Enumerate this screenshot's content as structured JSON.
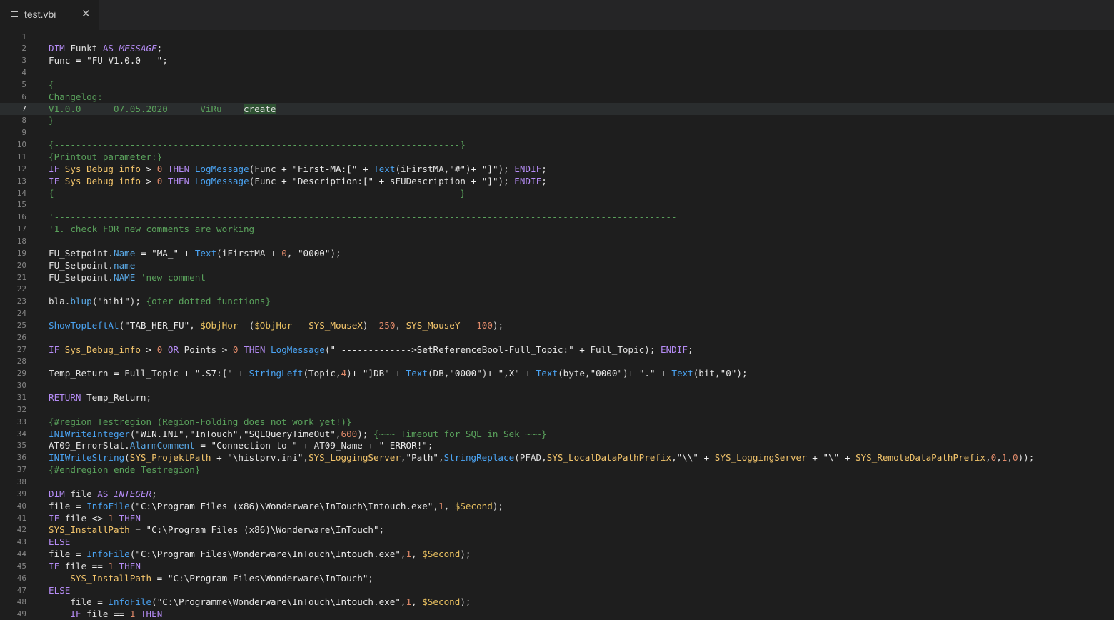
{
  "tab": {
    "title": "test.vbi",
    "icon": "file-lines-icon",
    "close_icon": "close-icon",
    "close_glyph": "✕"
  },
  "editor": {
    "current_line": 7,
    "lines": [
      [],
      [
        [
          "k",
          "DIM"
        ],
        [
          "x",
          " Funkt "
        ],
        [
          "k",
          "AS"
        ],
        [
          "x",
          " "
        ],
        [
          "t",
          "MESSAGE"
        ],
        [
          "x",
          ";"
        ]
      ],
      [
        [
          "x",
          "Func "
        ],
        [
          "o",
          "="
        ],
        [
          "x",
          " "
        ],
        [
          "s",
          "\"FU V1.0.0 - \""
        ],
        [
          "x",
          ";"
        ]
      ],
      [],
      [
        [
          "c",
          "{"
        ]
      ],
      [
        [
          "c",
          "Changelog:"
        ]
      ],
      [
        [
          "c",
          "V1.0.0      07.05.2020      ViRu    "
        ],
        [
          "hl",
          "create"
        ]
      ],
      [
        [
          "c",
          "}"
        ]
      ],
      [],
      [
        [
          "c",
          "{---------------------------------------------------------------------------}"
        ]
      ],
      [
        [
          "c",
          "{Printout parameter:}"
        ]
      ],
      [
        [
          "k",
          "IF"
        ],
        [
          "x",
          " "
        ],
        [
          "v",
          "Sys_Debug_info"
        ],
        [
          "x",
          " "
        ],
        [
          "o",
          ">"
        ],
        [
          "x",
          " "
        ],
        [
          "n",
          "0"
        ],
        [
          "x",
          " "
        ],
        [
          "k",
          "THEN"
        ],
        [
          "x",
          " "
        ],
        [
          "f",
          "LogMessage"
        ],
        [
          "x",
          "(Func "
        ],
        [
          "o",
          "+"
        ],
        [
          "x",
          " "
        ],
        [
          "s",
          "\"First-MA:[\""
        ],
        [
          "x",
          " "
        ],
        [
          "o",
          "+"
        ],
        [
          "x",
          " "
        ],
        [
          "f",
          "Text"
        ],
        [
          "x",
          "(iFirstMA,"
        ],
        [
          "s",
          "\"#\""
        ],
        [
          "x",
          ")"
        ],
        [
          "o",
          "+"
        ],
        [
          "x",
          " "
        ],
        [
          "s",
          "\"]\""
        ],
        [
          "x",
          "); "
        ],
        [
          "k",
          "ENDIF"
        ],
        [
          "x",
          ";"
        ]
      ],
      [
        [
          "k",
          "IF"
        ],
        [
          "x",
          " "
        ],
        [
          "v",
          "Sys_Debug_info"
        ],
        [
          "x",
          " "
        ],
        [
          "o",
          ">"
        ],
        [
          "x",
          " "
        ],
        [
          "n",
          "0"
        ],
        [
          "x",
          " "
        ],
        [
          "k",
          "THEN"
        ],
        [
          "x",
          " "
        ],
        [
          "f",
          "LogMessage"
        ],
        [
          "x",
          "(Func "
        ],
        [
          "o",
          "+"
        ],
        [
          "x",
          " "
        ],
        [
          "s",
          "\"Description:[\""
        ],
        [
          "x",
          " "
        ],
        [
          "o",
          "+"
        ],
        [
          "x",
          " sFUDescription "
        ],
        [
          "o",
          "+"
        ],
        [
          "x",
          " "
        ],
        [
          "s",
          "\"]\""
        ],
        [
          "x",
          "); "
        ],
        [
          "k",
          "ENDIF"
        ],
        [
          "x",
          ";"
        ]
      ],
      [
        [
          "c",
          "{---------------------------------------------------------------------------}"
        ]
      ],
      [],
      [
        [
          "c",
          "'-------------------------------------------------------------------------------------------------------------------"
        ]
      ],
      [
        [
          "c",
          "'1. check FOR new comments are working"
        ]
      ],
      [],
      [
        [
          "x",
          "FU_Setpoint."
        ],
        [
          "p",
          "Name"
        ],
        [
          "x",
          " "
        ],
        [
          "o",
          "="
        ],
        [
          "x",
          " "
        ],
        [
          "s",
          "\"MA_\""
        ],
        [
          "x",
          " "
        ],
        [
          "o",
          "+"
        ],
        [
          "x",
          " "
        ],
        [
          "f",
          "Text"
        ],
        [
          "x",
          "(iFirstMA "
        ],
        [
          "o",
          "+"
        ],
        [
          "x",
          " "
        ],
        [
          "n",
          "0"
        ],
        [
          "x",
          ", "
        ],
        [
          "s",
          "\"0000\""
        ],
        [
          "x",
          ");"
        ]
      ],
      [
        [
          "x",
          "FU_Setpoint."
        ],
        [
          "p",
          "name"
        ]
      ],
      [
        [
          "x",
          "FU_Setpoint."
        ],
        [
          "p",
          "NAME"
        ],
        [
          "x",
          " "
        ],
        [
          "c",
          "'new comment"
        ]
      ],
      [],
      [
        [
          "x",
          "bla."
        ],
        [
          "p",
          "blup"
        ],
        [
          "x",
          "("
        ],
        [
          "s",
          "\"hihi\""
        ],
        [
          "x",
          "); "
        ],
        [
          "c",
          "{oter dotted functions}"
        ]
      ],
      [],
      [
        [
          "f",
          "ShowTopLeftAt"
        ],
        [
          "x",
          "("
        ],
        [
          "s",
          "\"TAB_HER_FU\""
        ],
        [
          "x",
          ", "
        ],
        [
          "d",
          "$ObjHor"
        ],
        [
          "x",
          " "
        ],
        [
          "o",
          "-"
        ],
        [
          "x",
          "("
        ],
        [
          "d",
          "$ObjHor"
        ],
        [
          "x",
          " "
        ],
        [
          "o",
          "-"
        ],
        [
          "x",
          " "
        ],
        [
          "v",
          "SYS_MouseX"
        ],
        [
          "x",
          ")"
        ],
        [
          "o",
          "-"
        ],
        [
          "x",
          " "
        ],
        [
          "n",
          "250"
        ],
        [
          "x",
          ", "
        ],
        [
          "v",
          "SYS_MouseY"
        ],
        [
          "x",
          " "
        ],
        [
          "o",
          "-"
        ],
        [
          "x",
          " "
        ],
        [
          "n",
          "100"
        ],
        [
          "x",
          ");"
        ]
      ],
      [],
      [
        [
          "k",
          "IF"
        ],
        [
          "x",
          " "
        ],
        [
          "v",
          "Sys_Debug_info"
        ],
        [
          "x",
          " "
        ],
        [
          "o",
          ">"
        ],
        [
          "x",
          " "
        ],
        [
          "n",
          "0"
        ],
        [
          "x",
          " "
        ],
        [
          "k",
          "OR"
        ],
        [
          "x",
          " Points "
        ],
        [
          "o",
          ">"
        ],
        [
          "x",
          " "
        ],
        [
          "n",
          "0"
        ],
        [
          "x",
          " "
        ],
        [
          "k",
          "THEN"
        ],
        [
          "x",
          " "
        ],
        [
          "f",
          "LogMessage"
        ],
        [
          "x",
          "("
        ],
        [
          "s",
          "\" ------------->SetReferenceBool-Full_Topic:\""
        ],
        [
          "x",
          " "
        ],
        [
          "o",
          "+"
        ],
        [
          "x",
          " Full_Topic); "
        ],
        [
          "k",
          "ENDIF"
        ],
        [
          "x",
          ";"
        ]
      ],
      [],
      [
        [
          "x",
          "Temp_Return "
        ],
        [
          "o",
          "="
        ],
        [
          "x",
          " Full_Topic "
        ],
        [
          "o",
          "+"
        ],
        [
          "x",
          " "
        ],
        [
          "s",
          "\".S7:[\""
        ],
        [
          "x",
          " "
        ],
        [
          "o",
          "+"
        ],
        [
          "x",
          " "
        ],
        [
          "f",
          "StringLeft"
        ],
        [
          "x",
          "(Topic,"
        ],
        [
          "n",
          "4"
        ],
        [
          "x",
          ")"
        ],
        [
          "o",
          "+"
        ],
        [
          "x",
          " "
        ],
        [
          "s",
          "\"]DB\""
        ],
        [
          "x",
          " "
        ],
        [
          "o",
          "+"
        ],
        [
          "x",
          " "
        ],
        [
          "f",
          "Text"
        ],
        [
          "x",
          "(DB,"
        ],
        [
          "s",
          "\"0000\""
        ],
        [
          "x",
          ")"
        ],
        [
          "o",
          "+"
        ],
        [
          "x",
          " "
        ],
        [
          "s",
          "\",X\""
        ],
        [
          "x",
          " "
        ],
        [
          "o",
          "+"
        ],
        [
          "x",
          " "
        ],
        [
          "f",
          "Text"
        ],
        [
          "x",
          "(byte,"
        ],
        [
          "s",
          "\"0000\""
        ],
        [
          "x",
          ")"
        ],
        [
          "o",
          "+"
        ],
        [
          "x",
          " "
        ],
        [
          "s",
          "\".\""
        ],
        [
          "x",
          " "
        ],
        [
          "o",
          "+"
        ],
        [
          "x",
          " "
        ],
        [
          "f",
          "Text"
        ],
        [
          "x",
          "(bit,"
        ],
        [
          "s",
          "\"0\""
        ],
        [
          "x",
          ");"
        ]
      ],
      [],
      [
        [
          "k",
          "RETURN"
        ],
        [
          "x",
          " Temp_Return;"
        ]
      ],
      [],
      [
        [
          "c",
          "{#region Testregion (Region-Folding does not work yet!)}"
        ]
      ],
      [
        [
          "f",
          "INIWriteInteger"
        ],
        [
          "x",
          "("
        ],
        [
          "s",
          "\"WIN.INI\""
        ],
        [
          "x",
          ","
        ],
        [
          "s",
          "\"InTouch\""
        ],
        [
          "x",
          ","
        ],
        [
          "s",
          "\"SQLQueryTimeOut\""
        ],
        [
          "x",
          ","
        ],
        [
          "n",
          "600"
        ],
        [
          "x",
          "); "
        ],
        [
          "c",
          "{~~~ Timeout for SQL in Sek ~~~}"
        ]
      ],
      [
        [
          "x",
          "AT09_ErrorStat."
        ],
        [
          "p",
          "AlarmComment"
        ],
        [
          "x",
          " "
        ],
        [
          "o",
          "="
        ],
        [
          "x",
          " "
        ],
        [
          "s",
          "\"Connection to \""
        ],
        [
          "x",
          " "
        ],
        [
          "o",
          "+"
        ],
        [
          "x",
          " AT09_Name "
        ],
        [
          "o",
          "+"
        ],
        [
          "x",
          " "
        ],
        [
          "s",
          "\" ERROR!\""
        ],
        [
          "x",
          ";"
        ]
      ],
      [
        [
          "f",
          "INIWriteString"
        ],
        [
          "x",
          "("
        ],
        [
          "v",
          "SYS_ProjektPath"
        ],
        [
          "x",
          " "
        ],
        [
          "o",
          "+"
        ],
        [
          "x",
          " "
        ],
        [
          "s",
          "\"\\histprv.ini\""
        ],
        [
          "x",
          ","
        ],
        [
          "v",
          "SYS_LoggingServer"
        ],
        [
          "x",
          ","
        ],
        [
          "s",
          "\"Path\""
        ],
        [
          "x",
          ","
        ],
        [
          "f",
          "StringReplace"
        ],
        [
          "x",
          "(PFAD,"
        ],
        [
          "v",
          "SYS_LocalDataPathPrefix"
        ],
        [
          "x",
          ","
        ],
        [
          "s",
          "\"\\\\\""
        ],
        [
          "x",
          " "
        ],
        [
          "o",
          "+"
        ],
        [
          "x",
          " "
        ],
        [
          "v",
          "SYS_LoggingServer"
        ],
        [
          "x",
          " "
        ],
        [
          "o",
          "+"
        ],
        [
          "x",
          " "
        ],
        [
          "s",
          "\"\\\""
        ],
        [
          "x",
          " "
        ],
        [
          "o",
          "+"
        ],
        [
          "x",
          " "
        ],
        [
          "v",
          "SYS_RemoteDataPathPrefix"
        ],
        [
          "x",
          ","
        ],
        [
          "n",
          "0"
        ],
        [
          "x",
          ","
        ],
        [
          "n",
          "1"
        ],
        [
          "x",
          ","
        ],
        [
          "n",
          "0"
        ],
        [
          "x",
          "));"
        ]
      ],
      [
        [
          "c",
          "{#endregion ende Testregion}"
        ]
      ],
      [],
      [
        [
          "k",
          "DIM"
        ],
        [
          "x",
          " file "
        ],
        [
          "k",
          "AS"
        ],
        [
          "x",
          " "
        ],
        [
          "t",
          "INTEGER"
        ],
        [
          "x",
          ";"
        ]
      ],
      [
        [
          "x",
          "file "
        ],
        [
          "o",
          "="
        ],
        [
          "x",
          " "
        ],
        [
          "f",
          "InfoFile"
        ],
        [
          "x",
          "("
        ],
        [
          "s",
          "\"C:\\Program Files (x86)\\Wonderware\\InTouch\\Intouch.exe\""
        ],
        [
          "x",
          ","
        ],
        [
          "n",
          "1"
        ],
        [
          "x",
          ", "
        ],
        [
          "d",
          "$Second"
        ],
        [
          "x",
          ");"
        ]
      ],
      [
        [
          "k",
          "IF"
        ],
        [
          "x",
          " file "
        ],
        [
          "o",
          "<>"
        ],
        [
          "x",
          " "
        ],
        [
          "n",
          "1"
        ],
        [
          "x",
          " "
        ],
        [
          "k",
          "THEN"
        ]
      ],
      [
        [
          "v",
          "SYS_InstallPath"
        ],
        [
          "x",
          " "
        ],
        [
          "o",
          "="
        ],
        [
          "x",
          " "
        ],
        [
          "s",
          "\"C:\\Program Files (x86)\\Wonderware\\InTouch\""
        ],
        [
          "x",
          ";"
        ]
      ],
      [
        [
          "k",
          "ELSE"
        ]
      ],
      [
        [
          "x",
          "file "
        ],
        [
          "o",
          "="
        ],
        [
          "x",
          " "
        ],
        [
          "f",
          "InfoFile"
        ],
        [
          "x",
          "("
        ],
        [
          "s",
          "\"C:\\Program Files\\Wonderware\\InTouch\\Intouch.exe\""
        ],
        [
          "x",
          ","
        ],
        [
          "n",
          "1"
        ],
        [
          "x",
          ", "
        ],
        [
          "d",
          "$Second"
        ],
        [
          "x",
          ");"
        ]
      ],
      [
        [
          "k",
          "IF"
        ],
        [
          "x",
          " file "
        ],
        [
          "o",
          "=="
        ],
        [
          "x",
          " "
        ],
        [
          "n",
          "1"
        ],
        [
          "x",
          " "
        ],
        [
          "k",
          "THEN"
        ]
      ],
      [
        [
          "x",
          "    "
        ],
        [
          "v",
          "SYS_InstallPath"
        ],
        [
          "x",
          " "
        ],
        [
          "o",
          "="
        ],
        [
          "x",
          " "
        ],
        [
          "s",
          "\"C:\\Program Files\\Wonderware\\InTouch\""
        ],
        [
          "x",
          ";"
        ]
      ],
      [
        [
          "k",
          "ELSE"
        ]
      ],
      [
        [
          "x",
          "    file "
        ],
        [
          "o",
          "="
        ],
        [
          "x",
          " "
        ],
        [
          "f",
          "InfoFile"
        ],
        [
          "x",
          "("
        ],
        [
          "s",
          "\"C:\\Programme\\Wonderware\\InTouch\\Intouch.exe\""
        ],
        [
          "x",
          ","
        ],
        [
          "n",
          "1"
        ],
        [
          "x",
          ", "
        ],
        [
          "d",
          "$Second"
        ],
        [
          "x",
          ");"
        ]
      ],
      [
        [
          "x",
          "    "
        ],
        [
          "k",
          "IF"
        ],
        [
          "x",
          " file "
        ],
        [
          "o",
          "=="
        ],
        [
          "x",
          " "
        ],
        [
          "n",
          "1"
        ],
        [
          "x",
          " "
        ],
        [
          "k",
          "THEN"
        ]
      ]
    ]
  }
}
